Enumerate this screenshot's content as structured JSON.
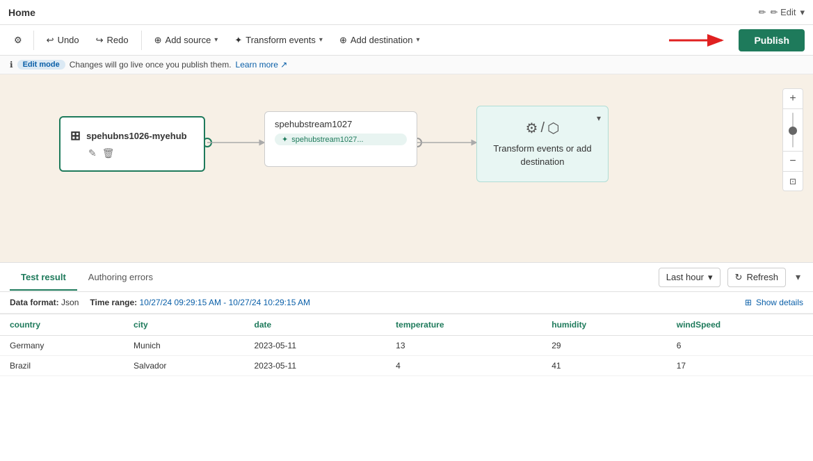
{
  "titleBar": {
    "title": "Home",
    "editLabel": "✏ Edit",
    "editDropdown": "▾"
  },
  "toolbar": {
    "gearIcon": "⚙",
    "undoLabel": "Undo",
    "redoLabel": "Redo",
    "addSourceLabel": "Add source",
    "transformEventsLabel": "Transform events",
    "addDestinationLabel": "Add destination",
    "publishLabel": "Publish"
  },
  "editModeBar": {
    "badgeText": "Edit mode",
    "message": "Changes will go live once you publish them.",
    "learnMoreText": "Learn more",
    "infoIcon": "ℹ"
  },
  "canvas": {
    "sourceNode": {
      "icon": "⊞",
      "title": "spehubns1026-myehub",
      "editIcon": "✎",
      "deleteIcon": "🗑"
    },
    "streamNode": {
      "title": "spehubstream1027",
      "tagIcon": "✦",
      "tagText": "spehubstream1027..."
    },
    "destinationNode": {
      "gearIcon": "⚙",
      "separator": "/",
      "exportIcon": "⬡",
      "text": "Transform events or add destination",
      "chevron": "▾"
    }
  },
  "bottomPanel": {
    "tabs": [
      {
        "label": "Test result",
        "active": true
      },
      {
        "label": "Authoring errors",
        "active": false
      }
    ],
    "lastHourLabel": "Last hour",
    "refreshLabel": "Refresh",
    "dataFormat": "Json",
    "dataFormatLabel": "Data format:",
    "timeRangeLabel": "Time range:",
    "timeRangeValue": "10/27/24 09:29:15 AM - 10/27/24 10:29:15 AM",
    "showDetailsLabel": "Show details",
    "table": {
      "columns": [
        "country",
        "city",
        "date",
        "temperature",
        "humidity",
        "windSpeed"
      ],
      "rows": [
        {
          "country": "Germany",
          "city": "Munich",
          "date": "2023-05-11",
          "temperature": "13",
          "humidity": "29",
          "windSpeed": "6"
        },
        {
          "country": "Brazil",
          "city": "Salvador",
          "date": "2023-05-11",
          "temperature": "4",
          "humidity": "41",
          "windSpeed": "17"
        }
      ]
    }
  }
}
